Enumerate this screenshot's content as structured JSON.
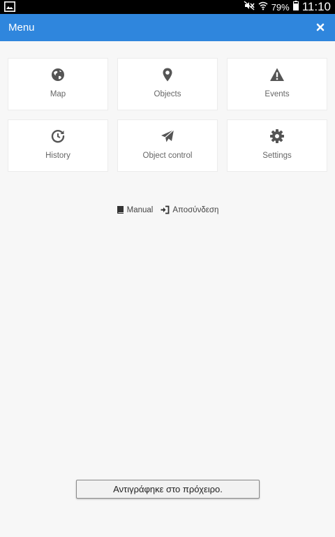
{
  "status_bar": {
    "battery_percent": "79%",
    "time": "11:10",
    "icons": [
      "gallery-icon",
      "mute-icon",
      "wifi-icon",
      "battery-icon"
    ]
  },
  "header": {
    "title": "Menu",
    "close_icon": "close-icon",
    "accent_color": "#2f86dd"
  },
  "menu": {
    "items": [
      {
        "label": "Map",
        "icon": "globe-icon"
      },
      {
        "label": "Objects",
        "icon": "map-pin-icon"
      },
      {
        "label": "Events",
        "icon": "warning-icon"
      },
      {
        "label": "History",
        "icon": "history-icon"
      },
      {
        "label": "Object control",
        "icon": "send-icon"
      },
      {
        "label": "Settings",
        "icon": "gear-icon"
      }
    ]
  },
  "footer_links": {
    "manual": {
      "label": "Manual",
      "icon": "book-icon"
    },
    "logout": {
      "label": "Αποσύνδεση",
      "icon": "sign-out-icon"
    }
  },
  "toast": {
    "message": "Αντιγράφηκε στο πρόχειρο."
  }
}
